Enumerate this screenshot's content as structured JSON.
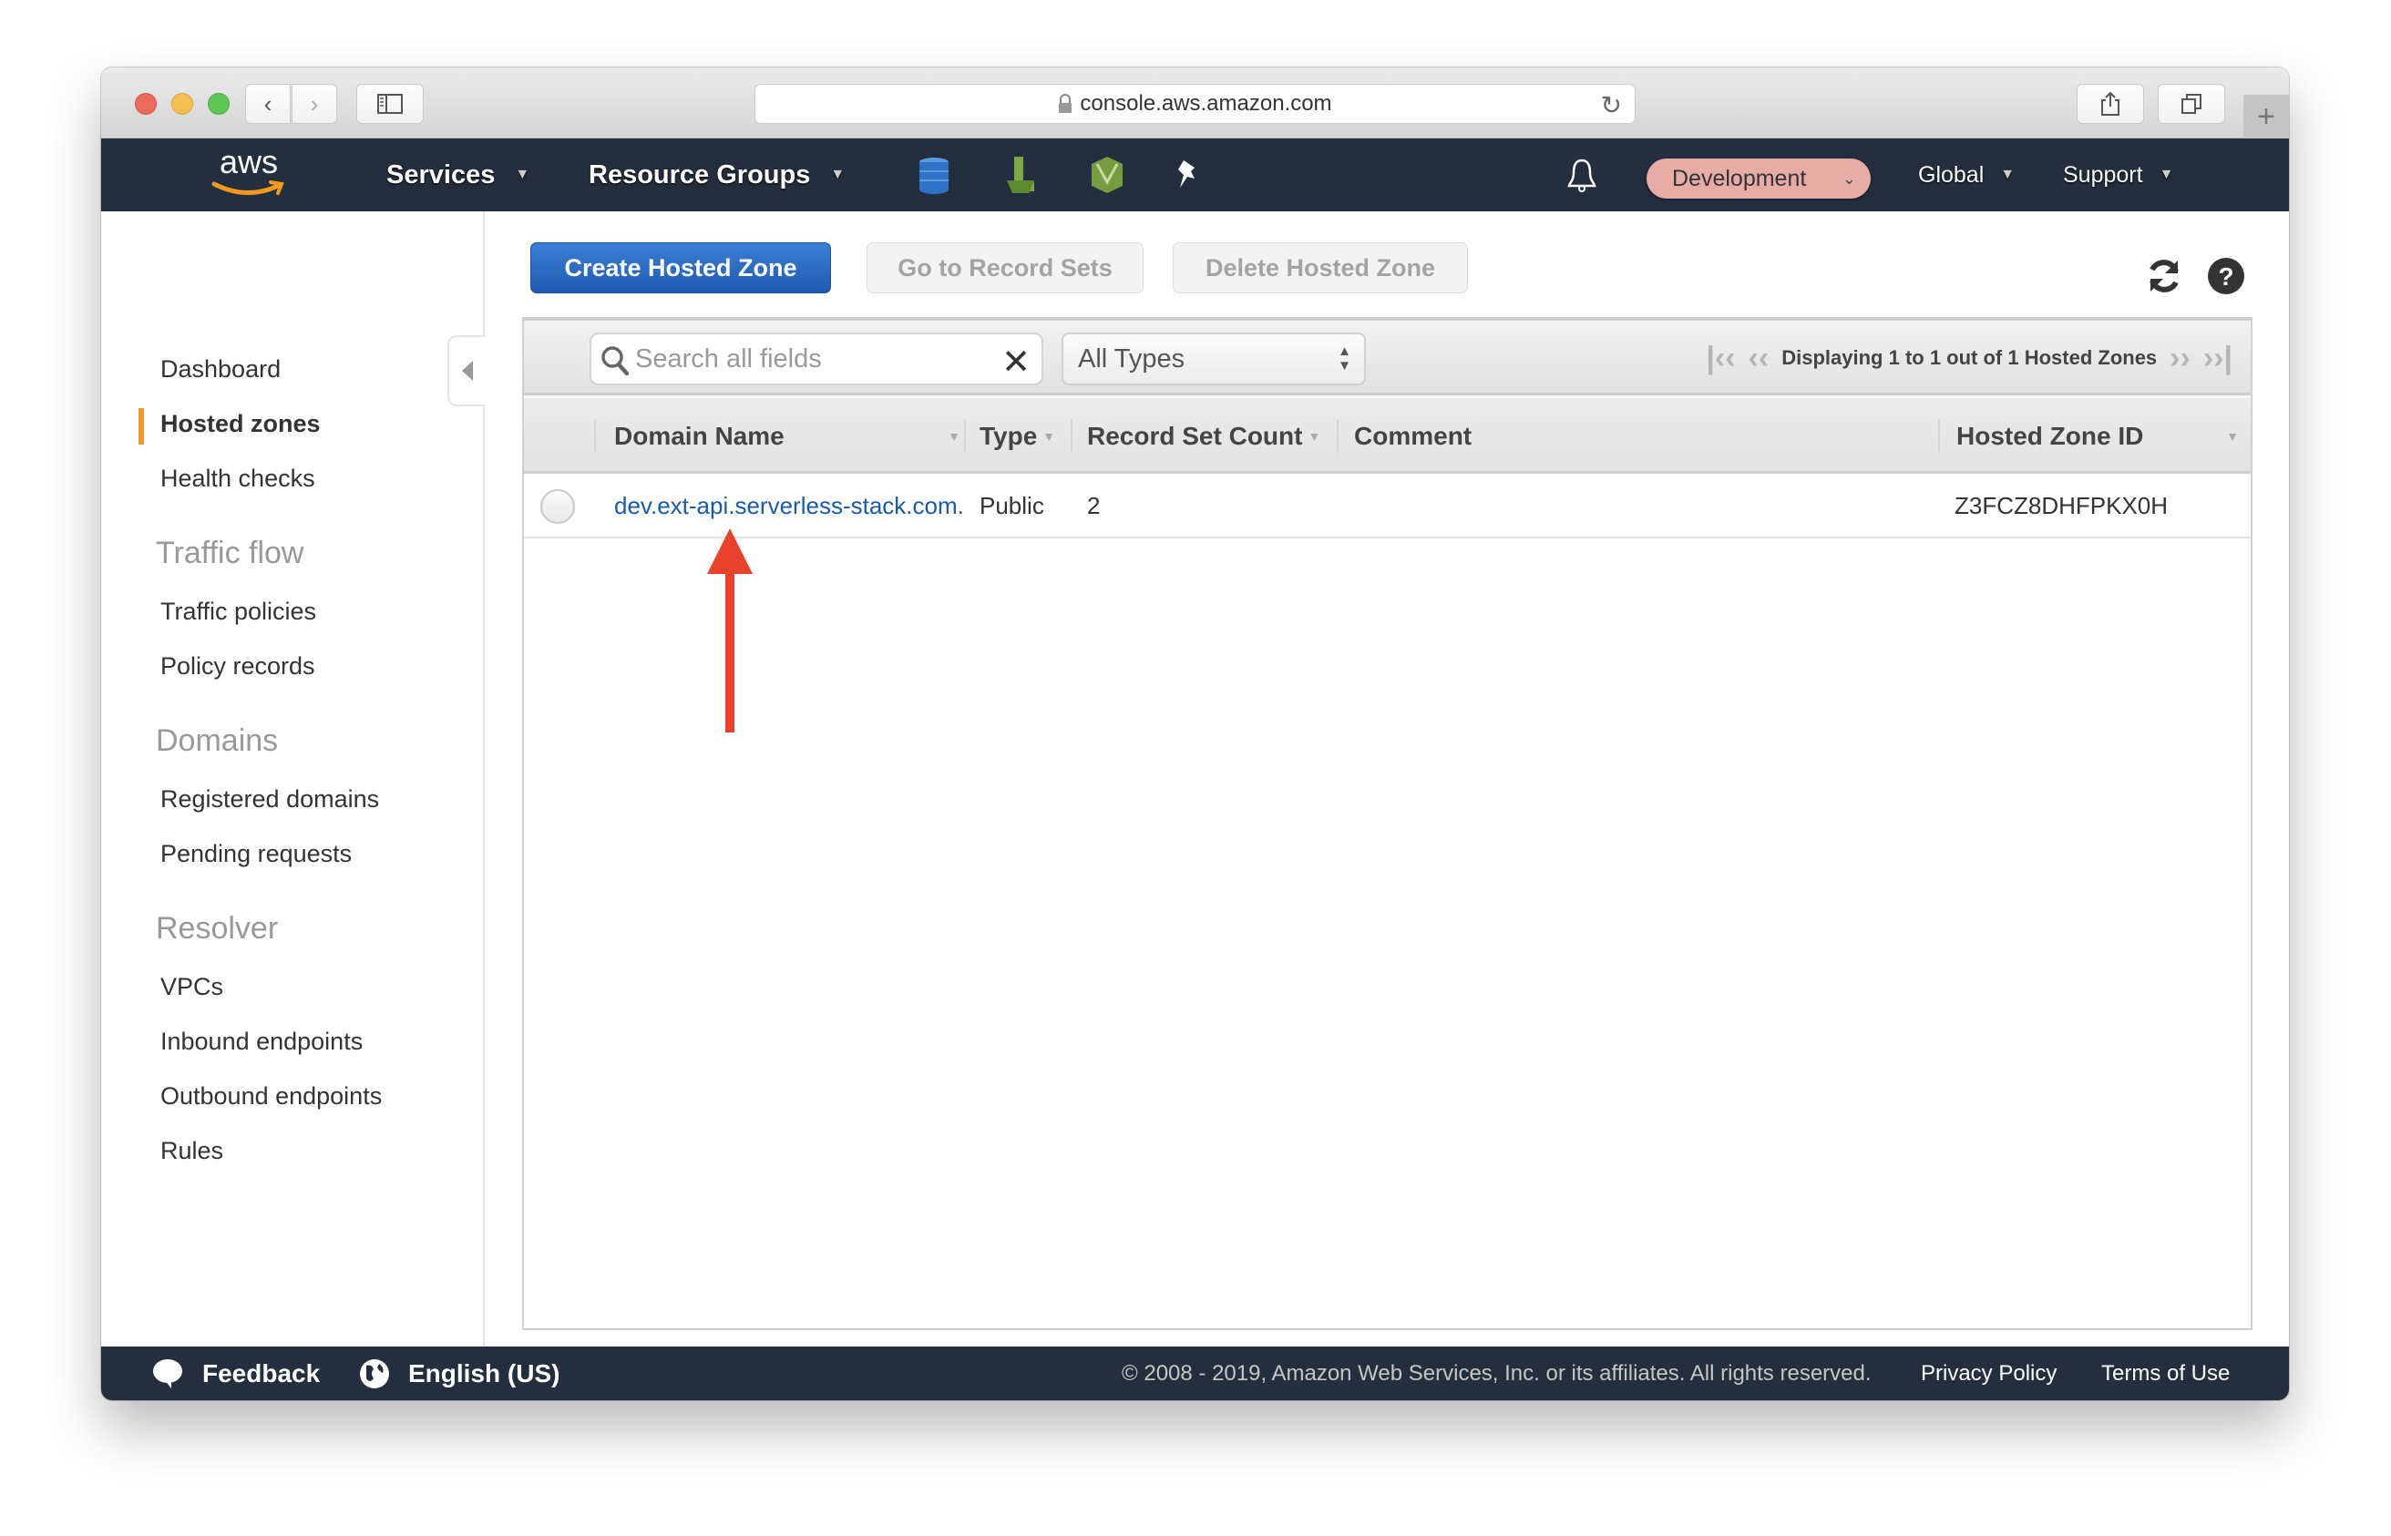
{
  "browser": {
    "url": "console.aws.amazon.com",
    "new_tab_label": "+"
  },
  "nav": {
    "logo_text": "aws",
    "services_label": "Services",
    "resource_groups_label": "Resource Groups",
    "pinned_services": [
      "dynamodb-icon",
      "elastic-beanstalk-icon",
      "cloudformation-icon"
    ],
    "account_label": "Development",
    "account_color": "#e8aca7",
    "region_label": "Global",
    "support_label": "Support"
  },
  "sidebar": {
    "items": [
      {
        "label": "Dashboard",
        "type": "item"
      },
      {
        "label": "Hosted zones",
        "type": "item",
        "active": true
      },
      {
        "label": "Health checks",
        "type": "item"
      },
      {
        "label": "Traffic flow",
        "type": "heading"
      },
      {
        "label": "Traffic policies",
        "type": "item"
      },
      {
        "label": "Policy records",
        "type": "item"
      },
      {
        "label": "Domains",
        "type": "heading"
      },
      {
        "label": "Registered domains",
        "type": "item"
      },
      {
        "label": "Pending requests",
        "type": "item"
      },
      {
        "label": "Resolver",
        "type": "heading"
      },
      {
        "label": "VPCs",
        "type": "item"
      },
      {
        "label": "Inbound endpoints",
        "type": "item"
      },
      {
        "label": "Outbound endpoints",
        "type": "item"
      },
      {
        "label": "Rules",
        "type": "item"
      }
    ],
    "active_color": "#f0962e"
  },
  "actions": {
    "create": "Create Hosted Zone",
    "go_to_record_sets": "Go to Record Sets",
    "delete": "Delete Hosted Zone"
  },
  "filter": {
    "search_placeholder": "Search all fields",
    "search_value": "",
    "type_select": "All Types"
  },
  "pager": {
    "text": "Displaying 1 to 1 out of 1 Hosted Zones"
  },
  "table": {
    "columns": [
      "Domain Name",
      "Type",
      "Record Set Count",
      "Comment",
      "Hosted Zone ID"
    ],
    "rows": [
      {
        "domain_name": "dev.ext-api.serverless-stack.com.",
        "type": "Public",
        "record_set_count": "2",
        "comment": "",
        "hosted_zone_id": "Z3FCZ8DHFPKX0H",
        "selected": false
      }
    ]
  },
  "annotation": {
    "type": "arrow",
    "color": "#e8412c",
    "points_to": "domain-name-link"
  },
  "footer": {
    "feedback": "Feedback",
    "language": "English (US)",
    "copyright": "© 2008 - 2019, Amazon Web Services, Inc. or its affiliates. All rights reserved.",
    "privacy": "Privacy Policy",
    "terms": "Terms of Use"
  }
}
